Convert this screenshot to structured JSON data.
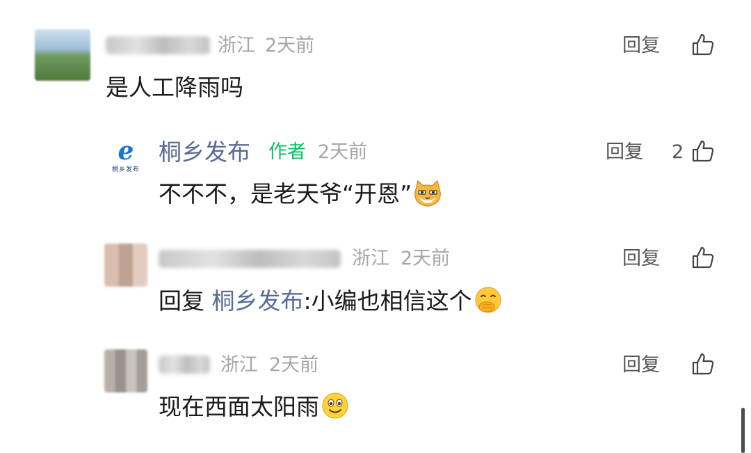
{
  "comments": [
    {
      "location": "浙江",
      "time": "2天前",
      "content": "是人工降雨吗",
      "reply_label": "回复",
      "like_count": ""
    },
    {
      "author": "桐乡发布",
      "badge": "作者",
      "logo_sub": "桐乡发布",
      "time": "2天前",
      "content": "不不不，是老天爷“开恩”",
      "reply_label": "回复",
      "like_count": "2"
    },
    {
      "location": "浙江",
      "time": "2天前",
      "reply_prefix": "回复",
      "reply_to": "桐乡发布",
      "content": ":小编也相信这个",
      "reply_label": "回复",
      "like_count": ""
    },
    {
      "location": "浙江",
      "time": "2天前",
      "content": "现在西面太阳雨",
      "reply_label": "回复",
      "like_count": ""
    }
  ],
  "icons": {
    "like": "thumbs-up-icon",
    "emoji_cat": "cat-face-emoji",
    "emoji_think": "thinking-hand-emoji",
    "emoji_smile": "smiling-face-emoji"
  },
  "colors": {
    "author_link": "#576b95",
    "author_badge": "#07c160",
    "meta": "#a6a6a6",
    "text": "#1a1a1a"
  }
}
